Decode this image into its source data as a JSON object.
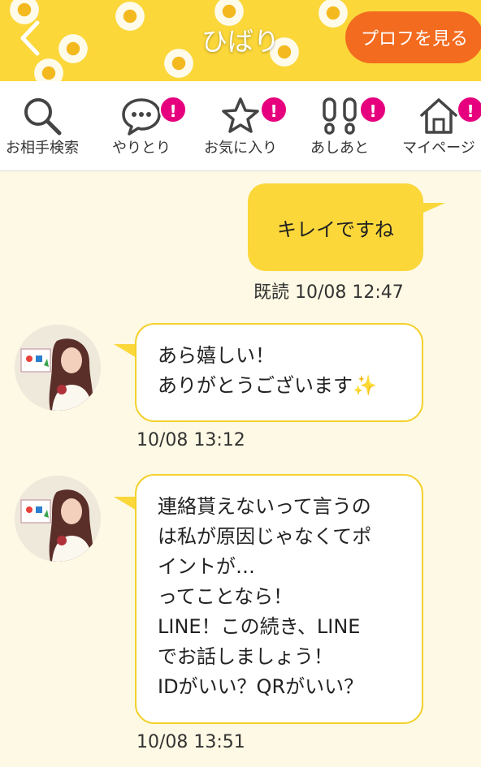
{
  "header": {
    "title": "ひばり",
    "profile_button": "プロフを見る"
  },
  "nav": [
    {
      "label": "お相手検索",
      "icon": "search-icon",
      "badge": ""
    },
    {
      "label": "やりとり",
      "icon": "chat-bubble-icon",
      "badge": "!"
    },
    {
      "label": "お気に入り",
      "icon": "star-icon",
      "badge": "!"
    },
    {
      "label": "あしあと",
      "icon": "footprints-icon",
      "badge": "!"
    },
    {
      "label": "マイページ",
      "icon": "home-icon",
      "badge": "!"
    }
  ],
  "messages": [
    {
      "from": "me",
      "text": "キレイですね",
      "meta": "既読 10/08 12:47"
    },
    {
      "from": "them",
      "text": "あら嬉しい！\nありがとうございます✨",
      "meta": "10/08 13:12"
    },
    {
      "from": "them",
      "text": "連絡貰えないって言うの\nは私が原因じゃなくてポ\nイントが…\nってことなら！\nLINE！この続き、LINE\nでお話しましょう！\nIDがいい？QRがいい？",
      "meta": "10/08 13:51"
    }
  ],
  "colors": {
    "accent_yellow": "#fbd73a",
    "profile_orange": "#f36b1f",
    "badge_pink": "#e6007e",
    "background": "#fdf9e4"
  }
}
